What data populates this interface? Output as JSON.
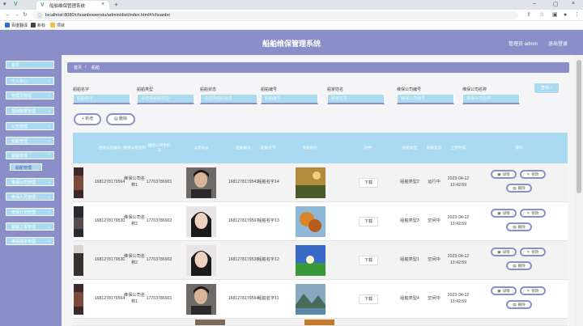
{
  "browser": {
    "tab_title": "船舶维保管理系统",
    "url": "localhost:8080/chuanbowenxiu/admin/dist/index.html#/chuanbo",
    "bookmarks": [
      "百度翻译",
      "新标",
      "项目"
    ]
  },
  "header": {
    "title": "船舶维保管理系统",
    "user_label": "管理员 admin",
    "logout_label": "退出登录"
  },
  "sidebar": {
    "items": [
      {
        "label": "首页",
        "has_chevron": false
      },
      {
        "label": "个人中心",
        "has_chevron": true
      },
      {
        "label": "管理员管理",
        "has_chevron": true
      },
      {
        "label": "基础数据管理",
        "has_chevron": true
      },
      {
        "label": "公告管理",
        "has_chevron": true
      },
      {
        "label": "船舶管理",
        "has_chevron": true
      },
      {
        "label": "船舶管理",
        "has_chevron": true
      },
      {
        "label": "维保公司管理",
        "has_chevron": true
      },
      {
        "label": "维保人员管理",
        "has_chevron": true
      },
      {
        "label": "维保计划管理",
        "has_chevron": true
      },
      {
        "label": "船舶上报管理",
        "has_chevron": true
      },
      {
        "label": "维保成本管理",
        "has_chevron": true
      }
    ],
    "sub_item": "船舶管理"
  },
  "breadcrumb": {
    "home": "首页",
    "sep": "/",
    "current": "船舶"
  },
  "filters": [
    {
      "label": "船舶名字",
      "placeholder": "船舶名字"
    },
    {
      "label": "船舶类型",
      "placeholder": "请选择船舶类型"
    },
    {
      "label": "船舶状态",
      "placeholder": "请选择船舶状态"
    },
    {
      "label": "船舶编号",
      "placeholder": "船舶编号"
    },
    {
      "label": "船家姓名",
      "placeholder": "船家姓名"
    },
    {
      "label": "维保公司编号",
      "placeholder": "维保公司编号"
    },
    {
      "label": "维保公司名称",
      "placeholder": "维保公司名称"
    }
  ],
  "search_label": "查询 ⌕",
  "actions": {
    "add": "+ 新增",
    "delete": "删除"
  },
  "table": {
    "headers": [
      "维保公司编号",
      "维保公司名称",
      "维保公司手机号",
      "公司logo",
      "船舶编号",
      "船舶名字",
      "船舶照片",
      "附件",
      "船舶类型",
      "船舶状态",
      "上传时间",
      "操作"
    ],
    "download_label": "下载",
    "op_labels": {
      "detail": "详情",
      "edit": "修改",
      "delete": "删除"
    },
    "rows": [
      {
        "company_no": "1681278179564",
        "company_name": "维保公司名称1",
        "phone": "17703786901",
        "ship_no": "1681278179543",
        "ship_name": "船舶名字14",
        "ship_type": "船舶类型2",
        "status": "运行中",
        "time": "2023-04-12 13:42:59",
        "logo": "male",
        "photo": "autumn"
      },
      {
        "company_no": "1681278179530",
        "company_name": "维保公司名称2",
        "phone": "17703786902",
        "ship_no": "1681278179567",
        "ship_name": "船舶名字13",
        "ship_type": "船舶类型3",
        "status": "空闲中",
        "time": "2023-04-12 13:42:59",
        "logo": "female",
        "photo": "leaves"
      },
      {
        "company_no": "1681278179530",
        "company_name": "维保公司名称2",
        "phone": "17703786902",
        "ship_no": "1681278179538",
        "ship_name": "船舶名字12",
        "ship_type": "船舶类型1",
        "status": "空闲中",
        "time": "2023-04-12 13:42:59",
        "logo": "female",
        "photo": "meadow"
      },
      {
        "company_no": "1681278179564",
        "company_name": "维保公司名称1",
        "phone": "17703786901",
        "ship_no": "1681278179564",
        "ship_name": "船舶名字11",
        "ship_type": "船舶类型4",
        "status": "空闲中",
        "time": "2023-04-12 13:42:59",
        "logo": "male",
        "photo": "lake"
      }
    ]
  }
}
